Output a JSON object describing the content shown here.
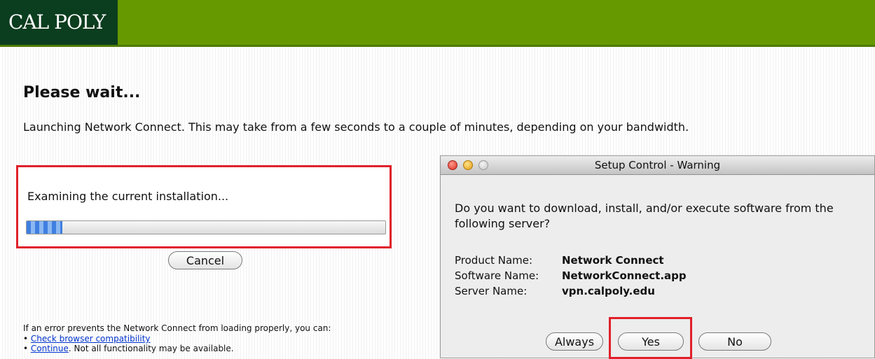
{
  "header": {
    "logo_text": "CAL POLY"
  },
  "page": {
    "title": "Please wait...",
    "intro": "Launching Network Connect. This may take from a few seconds to a couple of minutes, depending on your bandwidth."
  },
  "status": {
    "message": "Examining the current installation...",
    "progress_fraction": 0.1,
    "cancel_label": "Cancel"
  },
  "help": {
    "text": "If an error prevents the Network Connect from loading properly, you can:",
    "items": [
      {
        "link": "Check browser compatibility",
        "suffix": ""
      },
      {
        "link": "Continue",
        "suffix": ". Not all functionality may be available."
      }
    ]
  },
  "dialog": {
    "title": "Setup Control - Warning",
    "question": "Do you want to download, install, and/or execute software from the following server?",
    "fields": [
      {
        "label": "Product Name:",
        "value": "Network Connect"
      },
      {
        "label": "Software Name:",
        "value": "NetworkConnect.app"
      },
      {
        "label": "Server Name:",
        "value": "vpn.calpoly.edu"
      }
    ],
    "buttons": {
      "always": "Always",
      "yes": "Yes",
      "no": "No"
    }
  },
  "colors": {
    "banner": "#669900",
    "logo_bg": "#0b3d1f",
    "highlight": "#e0202a",
    "link": "#0033cc"
  }
}
